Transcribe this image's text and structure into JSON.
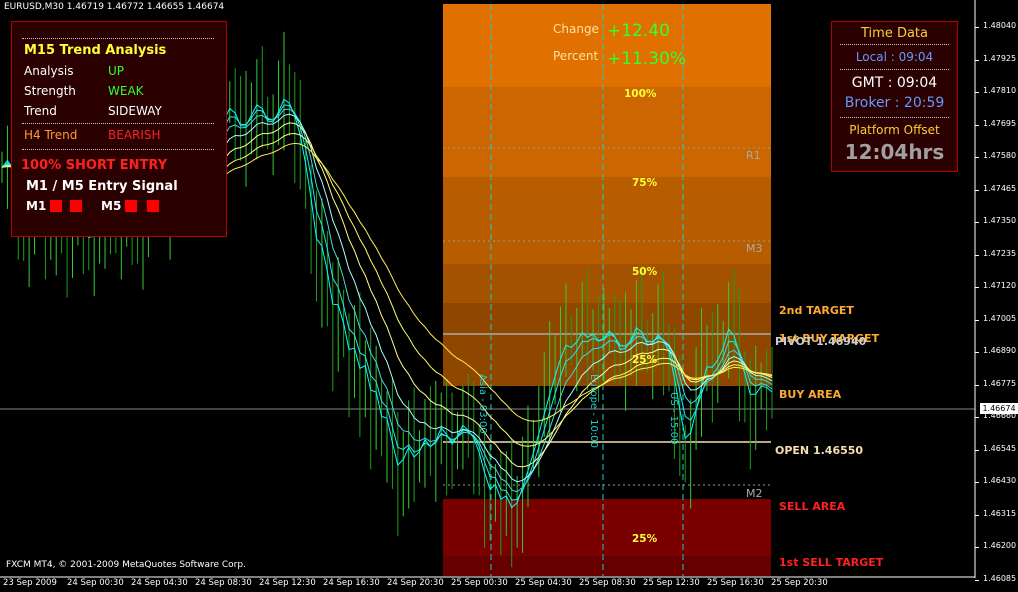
{
  "header": {
    "symbol_line": "EURUSD,M30  1.46719 1.46772 1.46655 1.46674"
  },
  "copyright": "FXCM MT4, © 2001-2009 MetaQuotes Software Corp.",
  "current_price": "1.46674",
  "price_axis": [
    "1.48040",
    "1.47925",
    "1.47810",
    "1.47695",
    "1.47580",
    "1.47465",
    "1.47350",
    "1.47235",
    "1.47120",
    "1.47005",
    "1.46890",
    "1.46775",
    "1.46660",
    "1.46545",
    "1.46430",
    "1.46315",
    "1.46200",
    "1.46085"
  ],
  "time_axis": [
    "23 Sep 2009",
    "24 Sep 00:30",
    "24 Sep 04:30",
    "24 Sep 08:30",
    "24 Sep 12:30",
    "24 Sep 16:30",
    "24 Sep 20:30",
    "25 Sep 00:30",
    "25 Sep 04:30",
    "25 Sep 08:30",
    "25 Sep 12:30",
    "25 Sep 16:30",
    "25 Sep 20:30"
  ],
  "change": {
    "change_label": "Change",
    "change_value": "+12.40",
    "percent_label": "Percent",
    "percent_value": "+11.30%"
  },
  "zones": {
    "upper_100": "100%",
    "upper_75": "75%",
    "upper_50": "50%",
    "upper_25": "25%",
    "lower_25": "25%"
  },
  "levels": {
    "r1": "R1",
    "m3": "M3",
    "m2": "M2",
    "second_target": "2nd TARGET",
    "first_buy_target": "1st BUY TARGET",
    "pivot": "PIVOT 1.46940",
    "buy_area": "BUY AREA",
    "open": "OPEN 1.46550",
    "sell_area": "SELL AREA",
    "first_sell_target": "1st SELL TARGET"
  },
  "sessions": {
    "asia": "Asia - 03:00",
    "europe": "Europe - 10:00",
    "us": "US - 15:00"
  },
  "trend_panel": {
    "title": "M15 Trend Analysis",
    "rows": [
      {
        "label": "Analysis",
        "value": "UP",
        "color": "#33ff33"
      },
      {
        "label": "Strength",
        "value": "WEAK",
        "color": "#33ff33"
      },
      {
        "label": "Trend",
        "value": "SIDEWAY",
        "color": "#ffffff"
      }
    ],
    "h4_label": "H4 Trend",
    "h4_value": "BEARISH",
    "entry": "100% SHORT ENTRY",
    "signal_title": "M1 /  M5 Entry Signal",
    "m1": "M1",
    "m5": "M5"
  },
  "time_panel": {
    "title": "Time Data",
    "local": "Local : 09:04",
    "gmt": "GMT : 09:04",
    "broker": "Broker : 20:59",
    "offset_label": "Platform Offset",
    "offset_value": "12:04hrs"
  },
  "colors": {
    "background": "#000000",
    "zone_orange": "#e07000",
    "sell_red": "#7a0000",
    "bull": "#33cc33",
    "ribbon_fast": "#00ffff",
    "ribbon_slow": "#ffff66"
  },
  "chart_data": {
    "type": "candlestick",
    "symbol": "EURUSD",
    "timeframe": "M30",
    "ylim": [
      1.46,
      1.481
    ],
    "current_price": 1.46674,
    "open_level": 1.4655,
    "pivot_level": 1.4694,
    "close": [
      1.4755,
      1.476,
      1.4752,
      1.4738,
      1.473,
      1.4735,
      1.4742,
      1.4736,
      1.4728,
      1.4732,
      1.474,
      1.4733,
      1.4726,
      1.4731,
      1.4738,
      1.473,
      1.4724,
      1.4729,
      1.4737,
      1.4742,
      1.4735,
      1.4728,
      1.4733,
      1.4741,
      1.4736,
      1.4729,
      1.4734,
      1.4743,
      1.475,
      1.4745,
      1.4738,
      1.4744,
      1.4752,
      1.4758,
      1.4764,
      1.477,
      1.4775,
      1.4768,
      1.476,
      1.4765,
      1.4772,
      1.4778,
      1.4782,
      1.4774,
      1.4766,
      1.4771,
      1.4779,
      1.4783,
      1.4776,
      1.4768,
      1.4772,
      1.478,
      1.4786,
      1.4778,
      1.477,
      1.476,
      1.4745,
      1.473,
      1.4712,
      1.4722,
      1.4705,
      1.469,
      1.4702,
      1.4688,
      1.4675,
      1.4686,
      1.467,
      1.468,
      1.466,
      1.4668,
      1.465,
      1.4658,
      1.464,
      1.4632,
      1.4645,
      1.4652,
      1.464,
      1.4648,
      1.4655,
      1.4645,
      1.4652,
      1.466,
      1.465,
      1.4645,
      1.4655,
      1.466,
      1.4652,
      1.4648,
      1.464,
      1.463,
      1.4625,
      1.4635,
      1.4622,
      1.463,
      1.462,
      1.4628,
      1.4638,
      1.4645,
      1.4652,
      1.466,
      1.4668,
      1.4675,
      1.4682,
      1.4688,
      1.4692,
      1.4685,
      1.469,
      1.4695,
      1.4688,
      1.4692,
      1.4686,
      1.469,
      1.4695,
      1.4688,
      1.468,
      1.4686,
      1.4692,
      1.4698,
      1.469,
      1.4682,
      1.4688,
      1.4694,
      1.4686,
      1.468,
      1.4664,
      1.465,
      1.464,
      1.4655,
      1.467,
      1.468,
      1.4686,
      1.4678,
      1.4684,
      1.469,
      1.47,
      1.4688,
      1.4676,
      1.4668,
      1.466,
      1.4668,
      1.4674,
      1.467,
      1.4667
    ],
    "ribbons": 7
  }
}
